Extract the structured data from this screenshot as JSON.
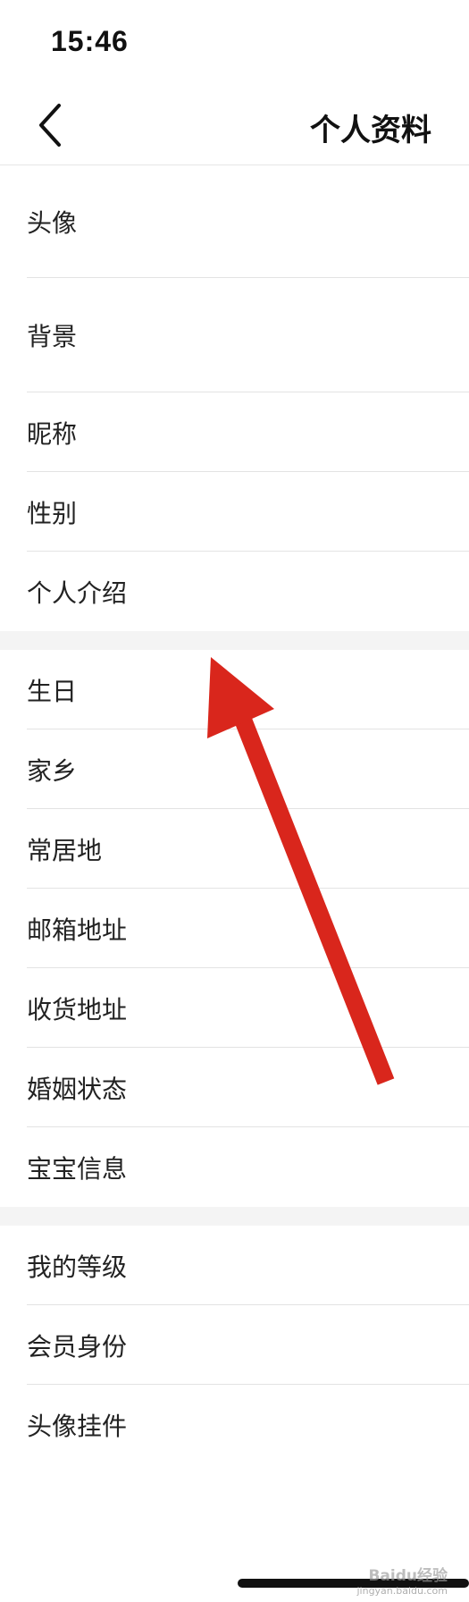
{
  "status_bar": {
    "time": "15:46"
  },
  "nav": {
    "title": "个人资料"
  },
  "groups": [
    {
      "items": [
        "头像",
        "背景",
        "昵称",
        "性别",
        "个人介绍"
      ]
    },
    {
      "items": [
        "生日",
        "家乡",
        "常居地",
        "邮箱地址",
        "收货地址",
        "婚姻状态",
        "宝宝信息"
      ]
    },
    {
      "items": [
        "我的等级",
        "会员身份",
        "头像挂件"
      ]
    }
  ],
  "watermark": {
    "logo": "Baidu经验",
    "url": "jingyan.baidu.com"
  },
  "colors": {
    "arrow": "#d9261c",
    "divider": "#e3e3e3",
    "section_gap": "#f4f4f4"
  }
}
